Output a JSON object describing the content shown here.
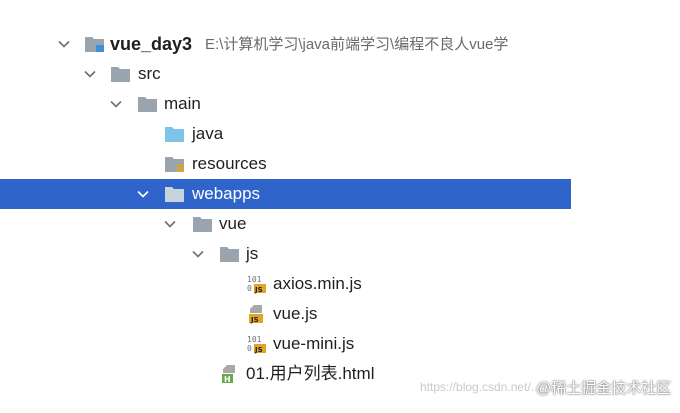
{
  "tree": {
    "project": {
      "name": "vue_day3",
      "path": "E:\\计算机学习\\java前端学习\\编程不良人vue学"
    },
    "src": "src",
    "main": "main",
    "java": "java",
    "resources": "resources",
    "webapps": "webapps",
    "vue": "vue",
    "js": "js",
    "files": {
      "axios": "axios.min.js",
      "vue": "vue.js",
      "vue_mini": "vue-mini.js",
      "html": "01.用户列表.html"
    },
    "file_badges": {
      "binary_top": "101",
      "binary_bottom": "0",
      "js": "JS",
      "html": "H"
    }
  },
  "watermark": {
    "url": "https://blog.csdn.net/...",
    "text": "@稀土掘金技术社区"
  },
  "colors": {
    "selection": "#2f65ca",
    "folder": "#9aa4ae",
    "source_folder": "#7ec3e8",
    "js_badge": "#e0a526",
    "html_badge": "#6aa84f"
  }
}
